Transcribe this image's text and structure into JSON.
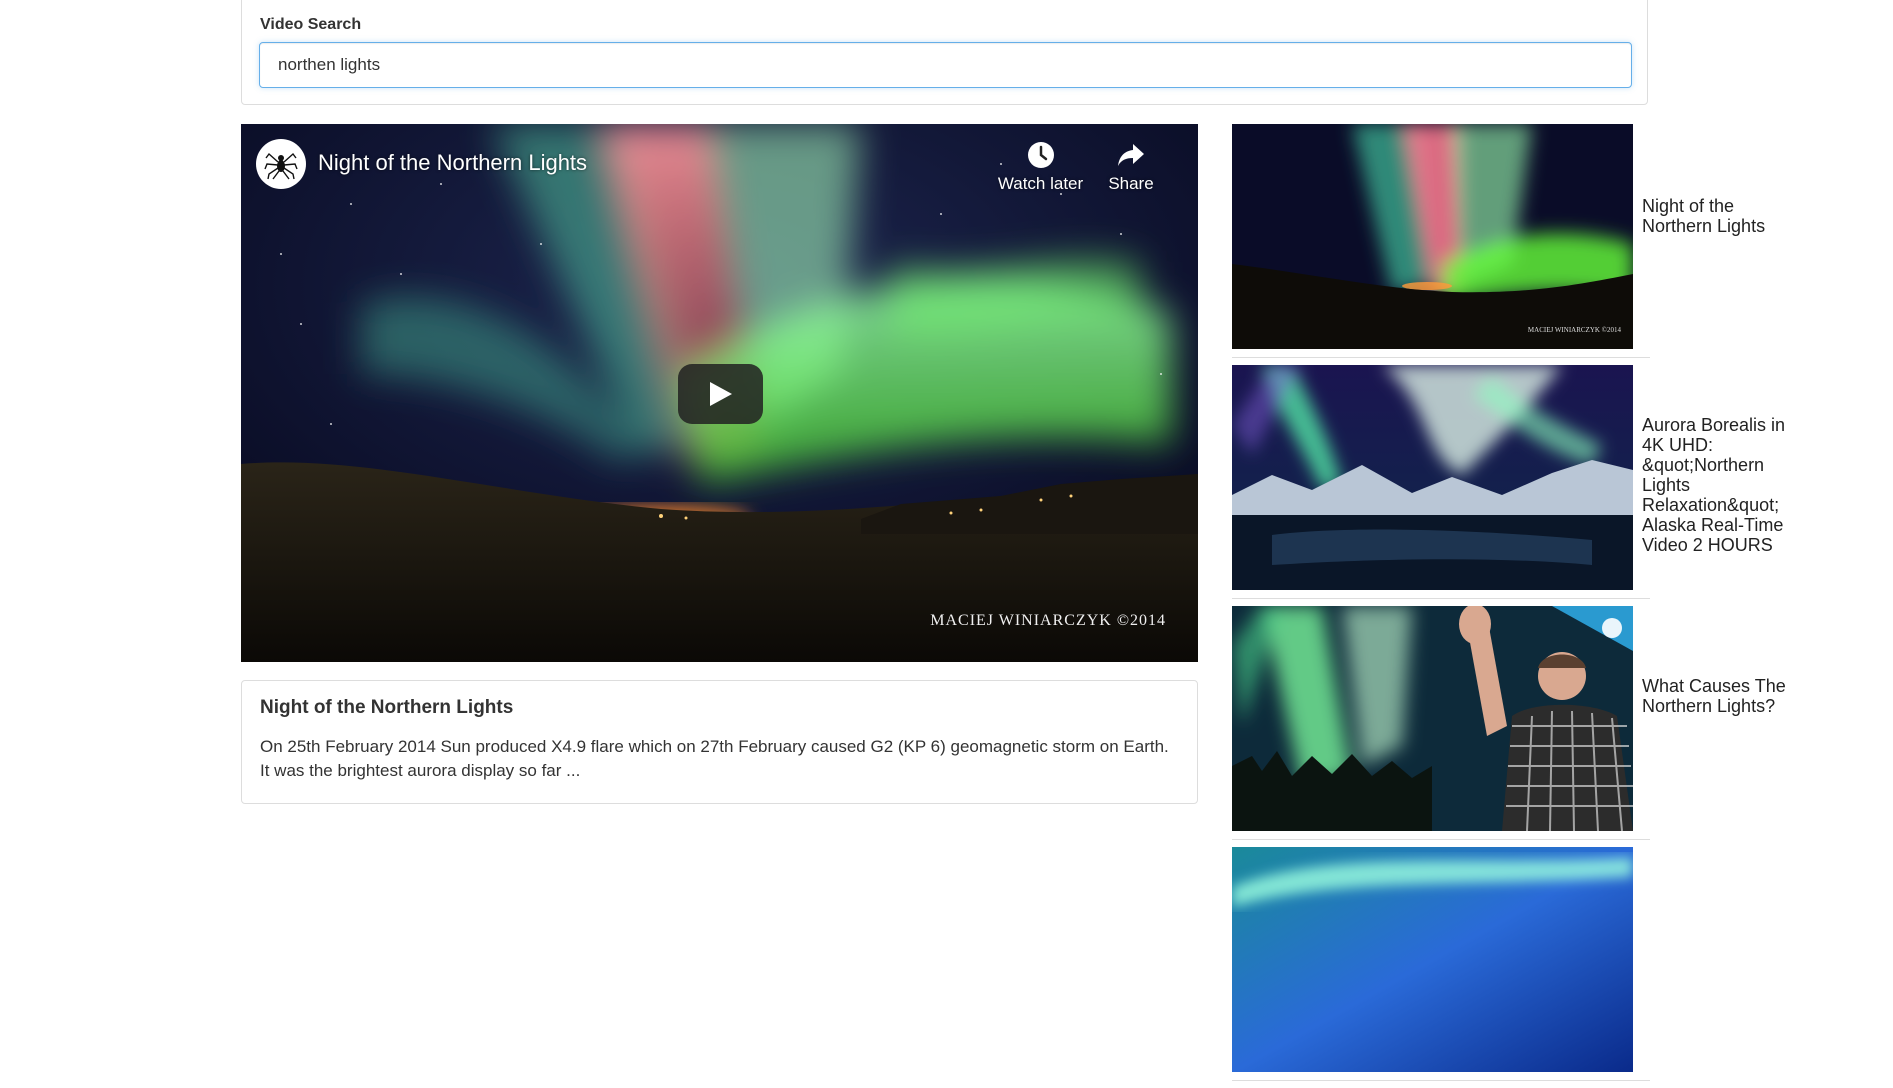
{
  "search": {
    "label": "Video Search",
    "value": "northen lights"
  },
  "player": {
    "title": "Night of the Northern Lights",
    "watch_later_label": "Watch later",
    "share_label": "Share",
    "watermark": "MACIEJ WINIARCZYK ©2014",
    "avatar_icon": "spider-icon",
    "play_icon": "play-icon"
  },
  "details": {
    "title": "Night of the Northern Lights",
    "description": "On 25th February 2014 Sun produced X4.9 flare which on 27th February caused G2 (KP 6) geomagnetic storm on Earth. It was the brightest aurora display so far ..."
  },
  "video_list": [
    {
      "title": "Night of the Northern Lights",
      "thumb_credit": "MACIEJ WINIARCZYK ©2014"
    },
    {
      "title": "Aurora Borealis in 4K UHD: &quot;Northern Lights Relaxation&quot; Alaska Real-Time Video 2 HOURS"
    },
    {
      "title": "What Causes The Northern Lights?"
    },
    {
      "title": ""
    }
  ],
  "colors": {
    "input_focus_border": "#66afe9",
    "panel_border": "#dddddd",
    "aurora_green": "#7dff5a",
    "aurora_pink": "#ff6a8a"
  }
}
